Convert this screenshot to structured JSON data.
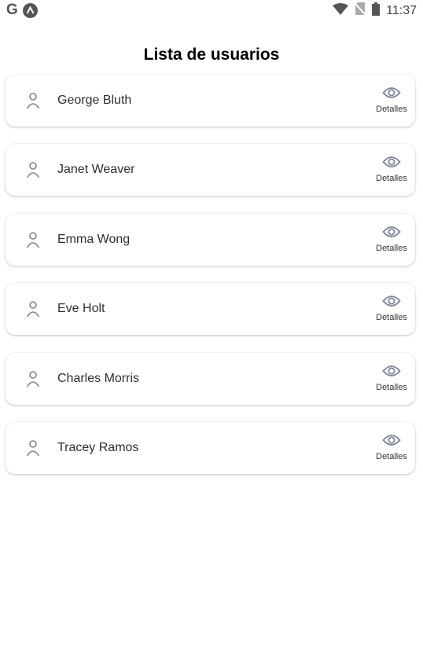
{
  "status_bar": {
    "time": "11:37",
    "icons": [
      "google-icon",
      "app-icon",
      "wifi-icon",
      "no-sim-icon",
      "battery-icon"
    ]
  },
  "page": {
    "title": "Lista de usuarios"
  },
  "users": [
    {
      "name": "George Bluth",
      "action_label": "Detalles"
    },
    {
      "name": "Janet Weaver",
      "action_label": "Detalles"
    },
    {
      "name": "Emma Wong",
      "action_label": "Detalles"
    },
    {
      "name": "Eve Holt",
      "action_label": "Detalles"
    },
    {
      "name": "Charles Morris",
      "action_label": "Detalles"
    },
    {
      "name": "Tracey Ramos",
      "action_label": "Detalles"
    }
  ],
  "colors": {
    "icon": "#7b8494",
    "text": "#2a2f36",
    "status": "#555555"
  }
}
